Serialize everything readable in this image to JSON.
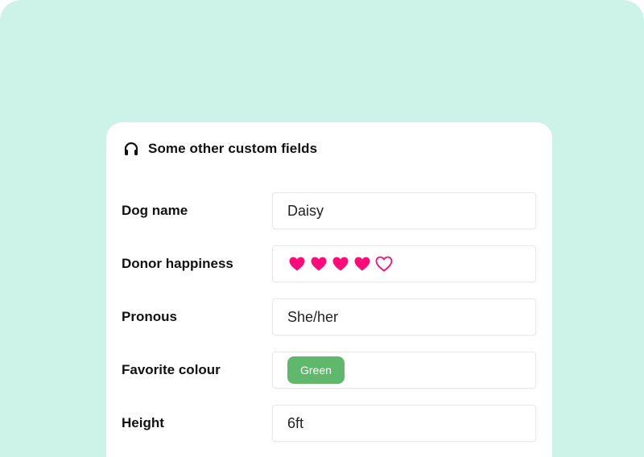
{
  "card": {
    "title": "Some other custom fields",
    "icon": "headphones-icon"
  },
  "fields": [
    {
      "label": "Dog name",
      "value": "Daisy"
    },
    {
      "label": "Donor happiness",
      "rating": 4,
      "rating_max": 5,
      "icon": "heart-icon",
      "color": "#ff0a78"
    },
    {
      "label": "Pronous",
      "value": "She/her"
    },
    {
      "label": "Favorite colour",
      "tag": "Green",
      "tag_color": "#5fb86b"
    },
    {
      "label": "Height",
      "value": "6ft"
    }
  ],
  "colors": {
    "background": "#cdf2e8",
    "card": "#ffffff",
    "heart": "#ff0a78"
  }
}
